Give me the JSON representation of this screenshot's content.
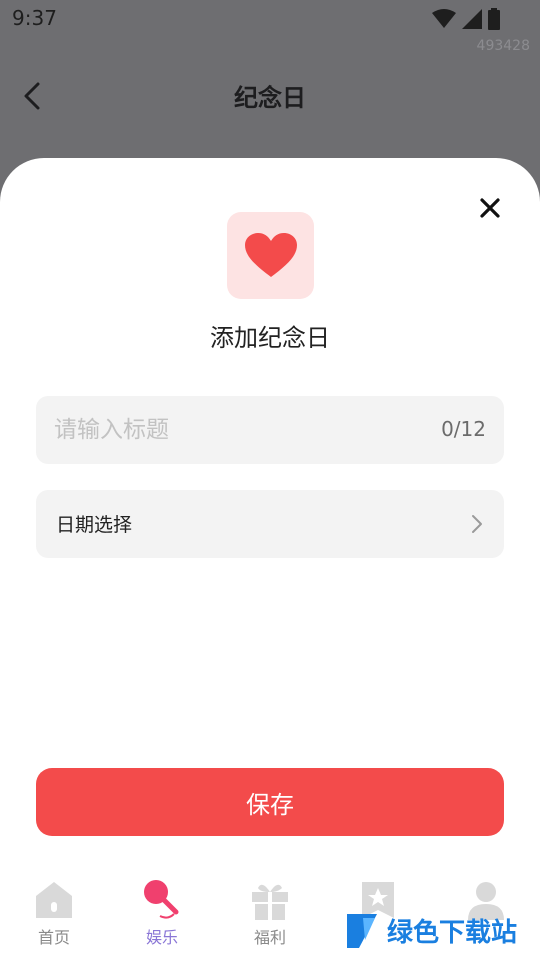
{
  "status_bar": {
    "time": "9:37"
  },
  "user_id": "493428",
  "header": {
    "title": "纪念日"
  },
  "sheet": {
    "title": "添加纪念日",
    "title_input": {
      "placeholder": "请输入标题",
      "value": "",
      "counter": "0/12"
    },
    "date_field": {
      "label": "日期选择"
    },
    "save_button": "保存"
  },
  "tabbar": {
    "items": [
      {
        "label": "首页",
        "icon": "home-icon",
        "active": false
      },
      {
        "label": "娱乐",
        "icon": "microphone-icon",
        "active": true
      },
      {
        "label": "福利",
        "icon": "gift-icon",
        "active": false
      },
      {
        "label": "",
        "icon": "badge-icon",
        "active": false
      },
      {
        "label": "",
        "icon": "profile-icon",
        "active": false
      }
    ]
  },
  "watermark": {
    "text": "绿色下载站"
  },
  "colors": {
    "accent_red": "#f34b4b",
    "heart_bg": "#fde3e3",
    "active_tab": "#8a76d6"
  }
}
